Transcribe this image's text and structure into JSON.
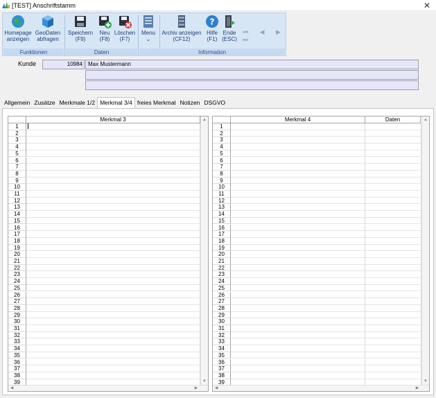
{
  "window": {
    "title": "[TEST] Anschriftstamm",
    "close_glyph": "✕"
  },
  "ribbon": {
    "buttons": [
      {
        "label1": "Homepage",
        "label2": "anzeigen",
        "icon": "globe-icon"
      },
      {
        "label1": "GeoDaten",
        "label2": "abfragen",
        "icon": "cube-icon"
      },
      {
        "label1": "Speichern",
        "label2": "(F9)",
        "icon": "floppy-icon"
      },
      {
        "label1": "Neu",
        "label2": "(F8)",
        "icon": "floppy-plus-icon"
      },
      {
        "label1": "Löschen",
        "label2": "(F7)",
        "icon": "floppy-delete-icon"
      },
      {
        "label1": "Menu",
        "label2": "⌄",
        "icon": "menu-icon"
      },
      {
        "label1": "Archiv anzeigen",
        "label2": "(CF12)",
        "icon": "archive-icon"
      },
      {
        "label1": "Hilfe",
        "label2": "(F1)",
        "icon": "help-icon"
      },
      {
        "label1": "Ende",
        "label2": "(ESC)",
        "icon": "exit-icon"
      }
    ],
    "groups": [
      "Funktionen",
      "Daten",
      "Information"
    ],
    "nav": "⏮ ◀ ▶ ⏭",
    "colors": {
      "ribbon_bg": "#d7e6f5",
      "label_color": "#1f3e7a"
    }
  },
  "kunde": {
    "label": "Kunde",
    "number": "10984",
    "name": "Max Mustermann"
  },
  "tabs": [
    "Allgemein",
    "Zusätze",
    "Merkmale 1/2",
    "Merkmal 3/4",
    "freies Merkmal",
    "Notizen",
    "DSGVO"
  ],
  "active_tab": "Merkmal 3/4",
  "grid_left": {
    "header": "Merkmal 3"
  },
  "grid_right": {
    "header1": "Merkmal 4",
    "header2": "Daten"
  },
  "row_numbers": [
    "1",
    "2",
    "3",
    "4",
    "5",
    "6",
    "7",
    "8",
    "9",
    "10",
    "11",
    "12",
    "13",
    "14",
    "15",
    "16",
    "17",
    "18",
    "19",
    "20",
    "21",
    "22",
    "23",
    "24",
    "25",
    "26",
    "27",
    "28",
    "29",
    "30",
    "31",
    "32",
    "33",
    "34",
    "35",
    "36",
    "37",
    "38",
    "39"
  ]
}
